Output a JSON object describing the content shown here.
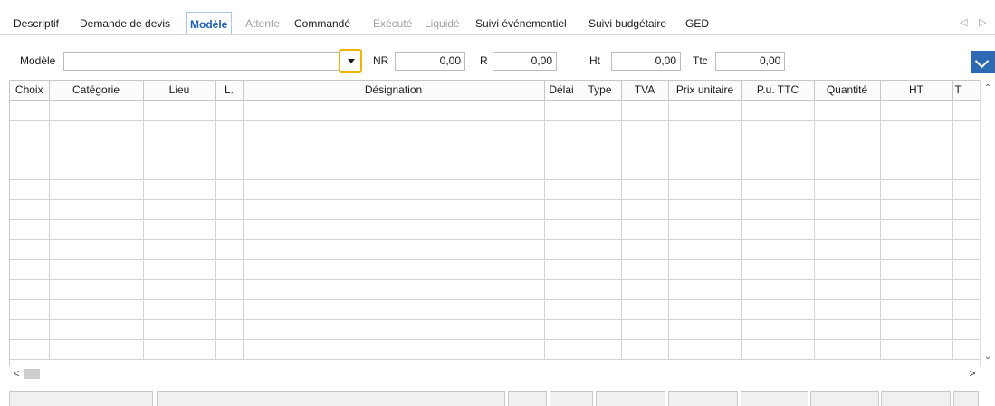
{
  "tabs": [
    {
      "label": "Descriptif",
      "state": "normal"
    },
    {
      "label": "Demande de devis",
      "state": "normal"
    },
    {
      "label": "Modèle",
      "state": "active"
    },
    {
      "label": "Attente",
      "state": "disabled"
    },
    {
      "label": "Commandé",
      "state": "normal"
    },
    {
      "label": "Exécuté",
      "state": "disabled"
    },
    {
      "label": "Liquidé",
      "state": "disabled"
    },
    {
      "label": "Suivi événementiel",
      "state": "normal"
    },
    {
      "label": "Suivi budgétaire",
      "state": "normal"
    },
    {
      "label": "GED",
      "state": "normal"
    }
  ],
  "nav": {
    "prev_icon": "chevron-left-outline",
    "next_icon": "chevron-right-outline",
    "prev": "◁",
    "next": "▷"
  },
  "toolbar": {
    "modele_label": "Modèle",
    "modele_value": "",
    "nr_label": "NR",
    "nr_value": "0,00",
    "r_label": "R",
    "r_value": "0,00",
    "ht_label": "Ht",
    "ht_value": "0,00",
    "ttc_label": "Ttc",
    "ttc_value": "0,00"
  },
  "grid": {
    "columns": [
      "Choix",
      "Catégorie",
      "Lieu",
      "L.",
      "Désignation",
      "Délai",
      "Type",
      "TVA",
      "Prix unitaire",
      "P.u. TTC",
      "Quantité",
      "HT",
      "T"
    ],
    "row_count": 13
  },
  "scroll": {
    "up": "⌃",
    "down": "⌄",
    "left": "<",
    "right": ">"
  },
  "colors": {
    "accent": "#2e6ab3",
    "highlight": "#f0b400",
    "active_tab": "#1f5fae",
    "disabled": "#a0a0a0"
  }
}
